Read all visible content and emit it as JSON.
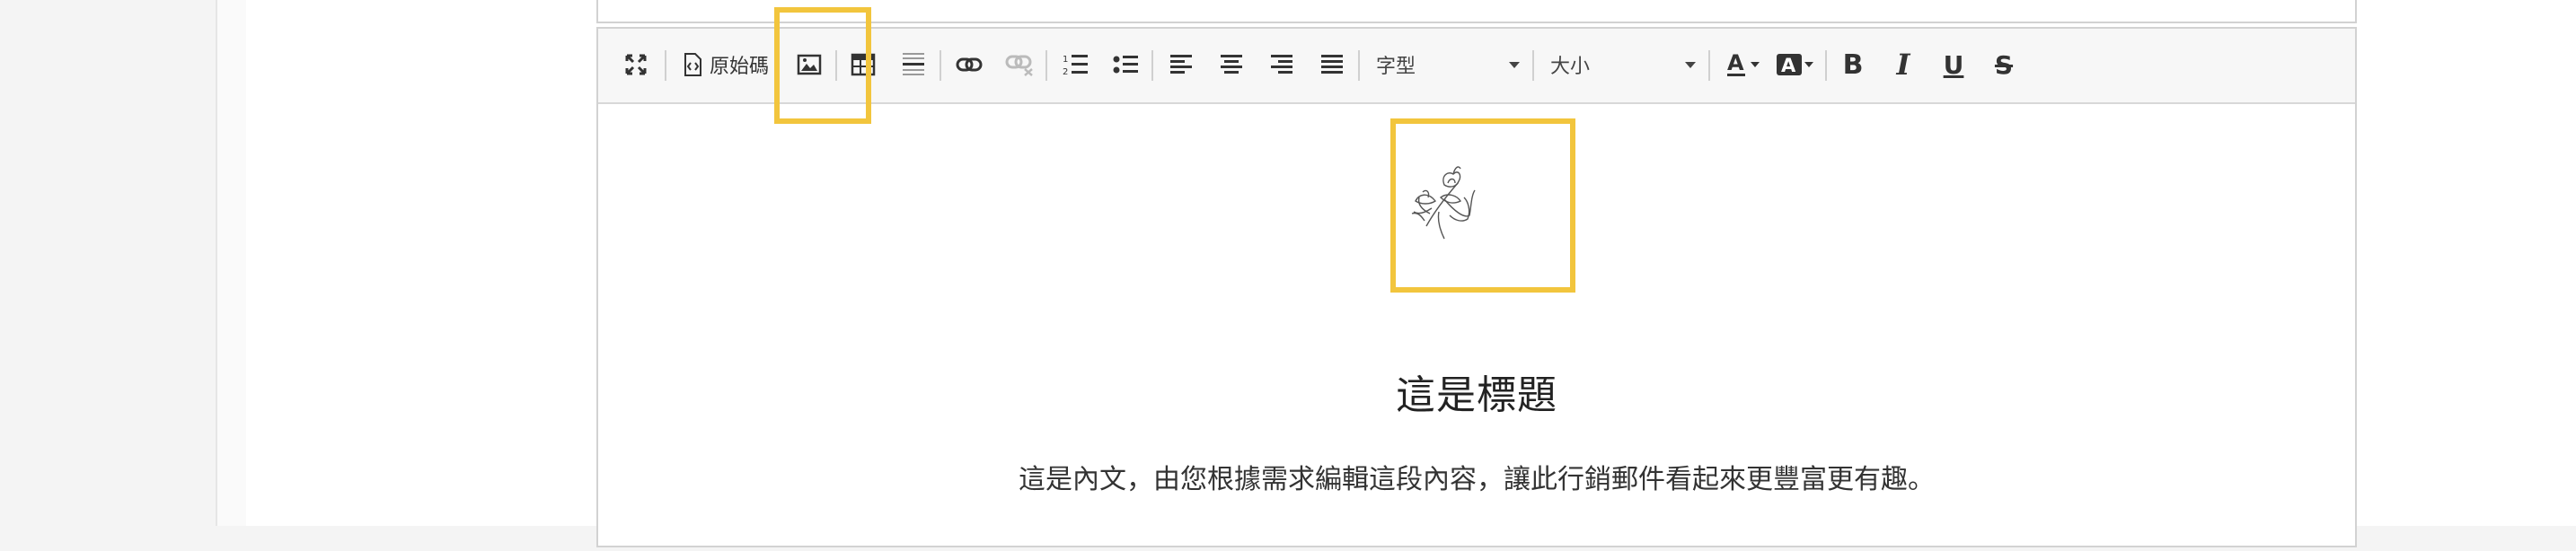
{
  "toolbar": {
    "source_label": "原始碼",
    "font_combo": "字型",
    "size_combo": "大小"
  },
  "content": {
    "heading": "這是標題",
    "body": "這是內文，由您根據需求編輯這段內容，讓此行銷郵件看起來更豐富更有趣。"
  },
  "colors": {
    "highlight": "#f2c53d",
    "toolbar_bg": "#f7f7f7",
    "border": "#d2d2d2"
  }
}
